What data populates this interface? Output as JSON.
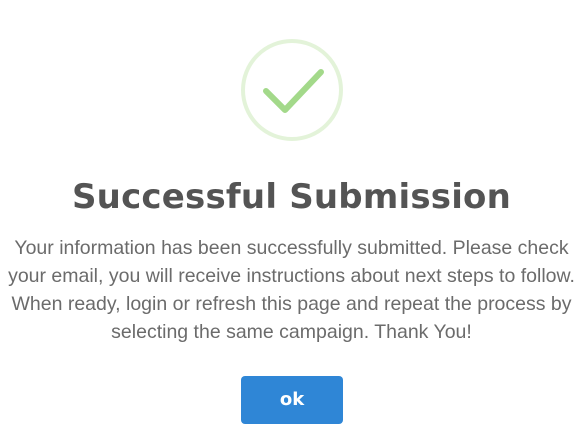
{
  "dialog": {
    "icon": "checkmark-circle-icon",
    "title": "Successful Submission",
    "message": "Your information has been successfully submitted. Please check your email, you will receive instructions about next steps to follow. When ready, login or refresh this page and repeat the process by selecting the same campaign. Thank You!",
    "ok_label": "ok"
  },
  "colors": {
    "success_ring": "#e3f3d9",
    "success_check": "#a3d98a",
    "title_text": "#545454",
    "body_text": "#6b6b6b",
    "button_bg": "#2f86d6",
    "button_text": "#ffffff"
  }
}
